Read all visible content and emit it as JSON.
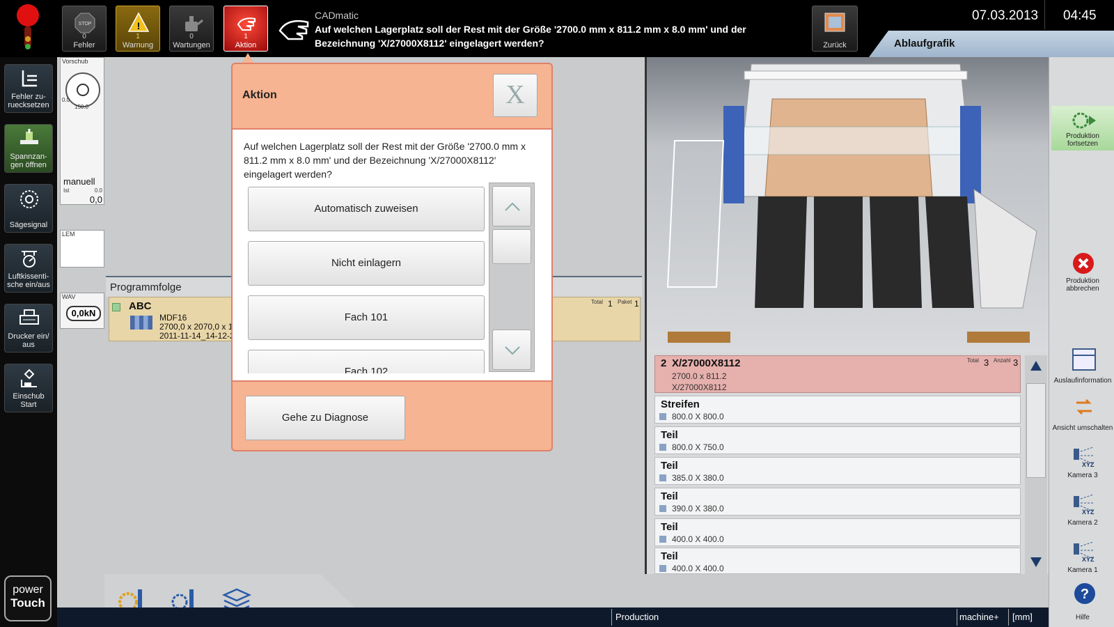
{
  "topbar": {
    "fehler": {
      "count": "0",
      "label": "Fehler"
    },
    "warnung": {
      "count": "1",
      "label": "Warnung"
    },
    "wartungen": {
      "count": "0",
      "label": "Wartungen"
    },
    "aktion": {
      "count": "1",
      "label": "Aktion"
    },
    "message_title": "CADmatic",
    "message_line1": "Auf welchen Lagerplatz soll der Rest mit der Größe '2700.0 mm x 811.2 mm x 8.0 mm' und der",
    "message_line2": "Bezeichnung 'X/27000X8112' eingelagert werden?",
    "back_label": "Zurück",
    "date": "07.03.2013",
    "time": "04:45",
    "tab_label": "Ablaufgrafik"
  },
  "leftbar": {
    "items": [
      {
        "label": "Fehler zu-rueck­setzen"
      },
      {
        "label": "Spannzan-gen öffnen"
      },
      {
        "label": "Sägesignal"
      },
      {
        "label": "Luftkissenti-sche ein/aus"
      },
      {
        "label": "Drucker ein/ aus"
      },
      {
        "label": "Einschub Start"
      }
    ],
    "logo_top": "power",
    "logo_bottom": "Touch"
  },
  "status": {
    "vorschub_label": "Vorschub",
    "scale_min": "0.0",
    "scale_max": "150.0",
    "manual_label": "manuell",
    "ist_label": "Ist",
    "ist_small": "0.0",
    "ist_value": "0,0",
    "lem_label": "LEM",
    "wav_label": "WAV",
    "force_value": "0,0kN"
  },
  "program": {
    "header": "Programmfolge",
    "name": "ABC",
    "material": "MDF16",
    "size": "2700,0 x 2070,0 x 1",
    "date": "2011-11-14_14-12-2",
    "total_label": "Total",
    "total_value": "1",
    "paket_label": "Paket",
    "paket_value": "1"
  },
  "dialog": {
    "title": "Aktion",
    "close": "X",
    "question": "Auf welchen Lagerplatz soll der Rest mit der Größe '2700.0 mm x 811.2 mm x 8.0 mm' und der Bezeichnung 'X/27000X8112' eingelagert werden?",
    "options": [
      "Automatisch zuweisen",
      "Nicht einlagern",
      "Fach 101",
      "Fach 102"
    ],
    "diagnose": "Gehe zu Diagnose"
  },
  "parts": {
    "header_num": "2",
    "header_name": "X/27000X8112",
    "header_size": "2700.0 x 811.2",
    "header_id": "X/27000X8112",
    "total_label": "Total",
    "total_value": "3",
    "anzahl_label": "Anzahl",
    "anzahl_value": "3",
    "items": [
      {
        "title": "Streifen",
        "dims": "800.0 X 800.0"
      },
      {
        "title": "Teil",
        "dims": "800.0 X 750.0"
      },
      {
        "title": "Teil",
        "dims": "385.0 X 380.0"
      },
      {
        "title": "Teil",
        "dims": "390.0 X 380.0"
      },
      {
        "title": "Teil",
        "dims": "400.0 X 400.0"
      },
      {
        "title": "Teil",
        "dims": "400.0 X 400.0"
      }
    ]
  },
  "rightbar": {
    "continue": "Produktion fortsetzen",
    "abort": "Produktion abbrechen",
    "outfeed": "Auslaufinformation",
    "switch_view": "Ansicht umschalten",
    "cam3": "Kamera 3",
    "cam2": "Kamera 2",
    "cam1": "Kamera 1",
    "help": "Hilfe"
  },
  "statusbar": {
    "mode": "Production",
    "machine": "machine+",
    "unit": "[mm]"
  }
}
